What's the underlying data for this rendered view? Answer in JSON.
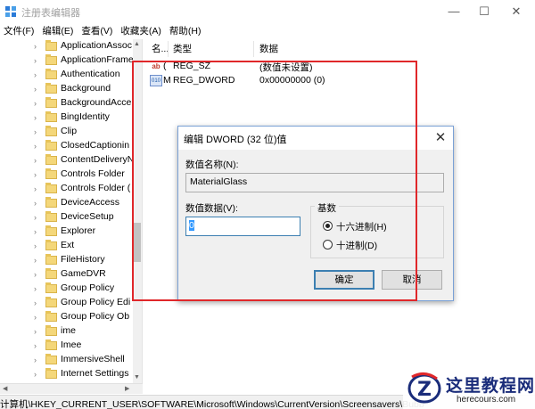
{
  "window": {
    "title": "注册表编辑器",
    "minimize": "—",
    "maximize": "☐",
    "close": "✕"
  },
  "menu": [
    "文件(F)",
    "编辑(E)",
    "查看(V)",
    "收藏夹(A)",
    "帮助(H)"
  ],
  "tree": {
    "items": [
      "ApplicationAssoc",
      "ApplicationFrame",
      "Authentication",
      "Background",
      "BackgroundAcce",
      "BingIdentity",
      "Clip",
      "ClosedCaptionin",
      "ContentDeliveryN",
      "Controls Folder",
      "Controls Folder (",
      "DeviceAccess",
      "DeviceSetup",
      "Explorer",
      "Ext",
      "FileHistory",
      "GameDVR",
      "Group Policy",
      "Group Policy Edi",
      "Group Policy Ob",
      "ime",
      "Imee",
      "ImmersiveShell",
      "Internet Settings"
    ]
  },
  "list": {
    "columns": {
      "name": "名...",
      "type": "类型",
      "data": "数据"
    },
    "rows": [
      {
        "name": "(",
        "type": "REG_SZ",
        "data": "(数值未设置)",
        "icon": "string-value-icon"
      },
      {
        "name": "M",
        "type": "REG_DWORD",
        "data": "0x00000000 (0)",
        "icon": "dword-value-icon"
      }
    ]
  },
  "dialog": {
    "title": "编辑 DWORD (32 位)值",
    "close": "✕",
    "name_label": "数值名称(N):",
    "name_value": "MaterialGlass",
    "data_label": "数值数据(V):",
    "data_value": "0",
    "base_label": "基数",
    "radio_hex": "十六进制(H)",
    "radio_dec": "十进制(D)",
    "selected_base": "hex",
    "ok": "确定",
    "cancel": "取消"
  },
  "statusbar": {
    "path": "计算机\\HKEY_CURRENT_USER\\SOFTWARE\\Microsoft\\Windows\\CurrentVersion\\Screensavers\\Bubb"
  },
  "watermark": {
    "title": "这里教程网",
    "url": "herecours.com"
  },
  "colors": {
    "annotation": "#e0272a",
    "selection": "#3399ff",
    "dialog_border": "#7aa1d6",
    "watermark_blue": "#1a2c7a"
  }
}
